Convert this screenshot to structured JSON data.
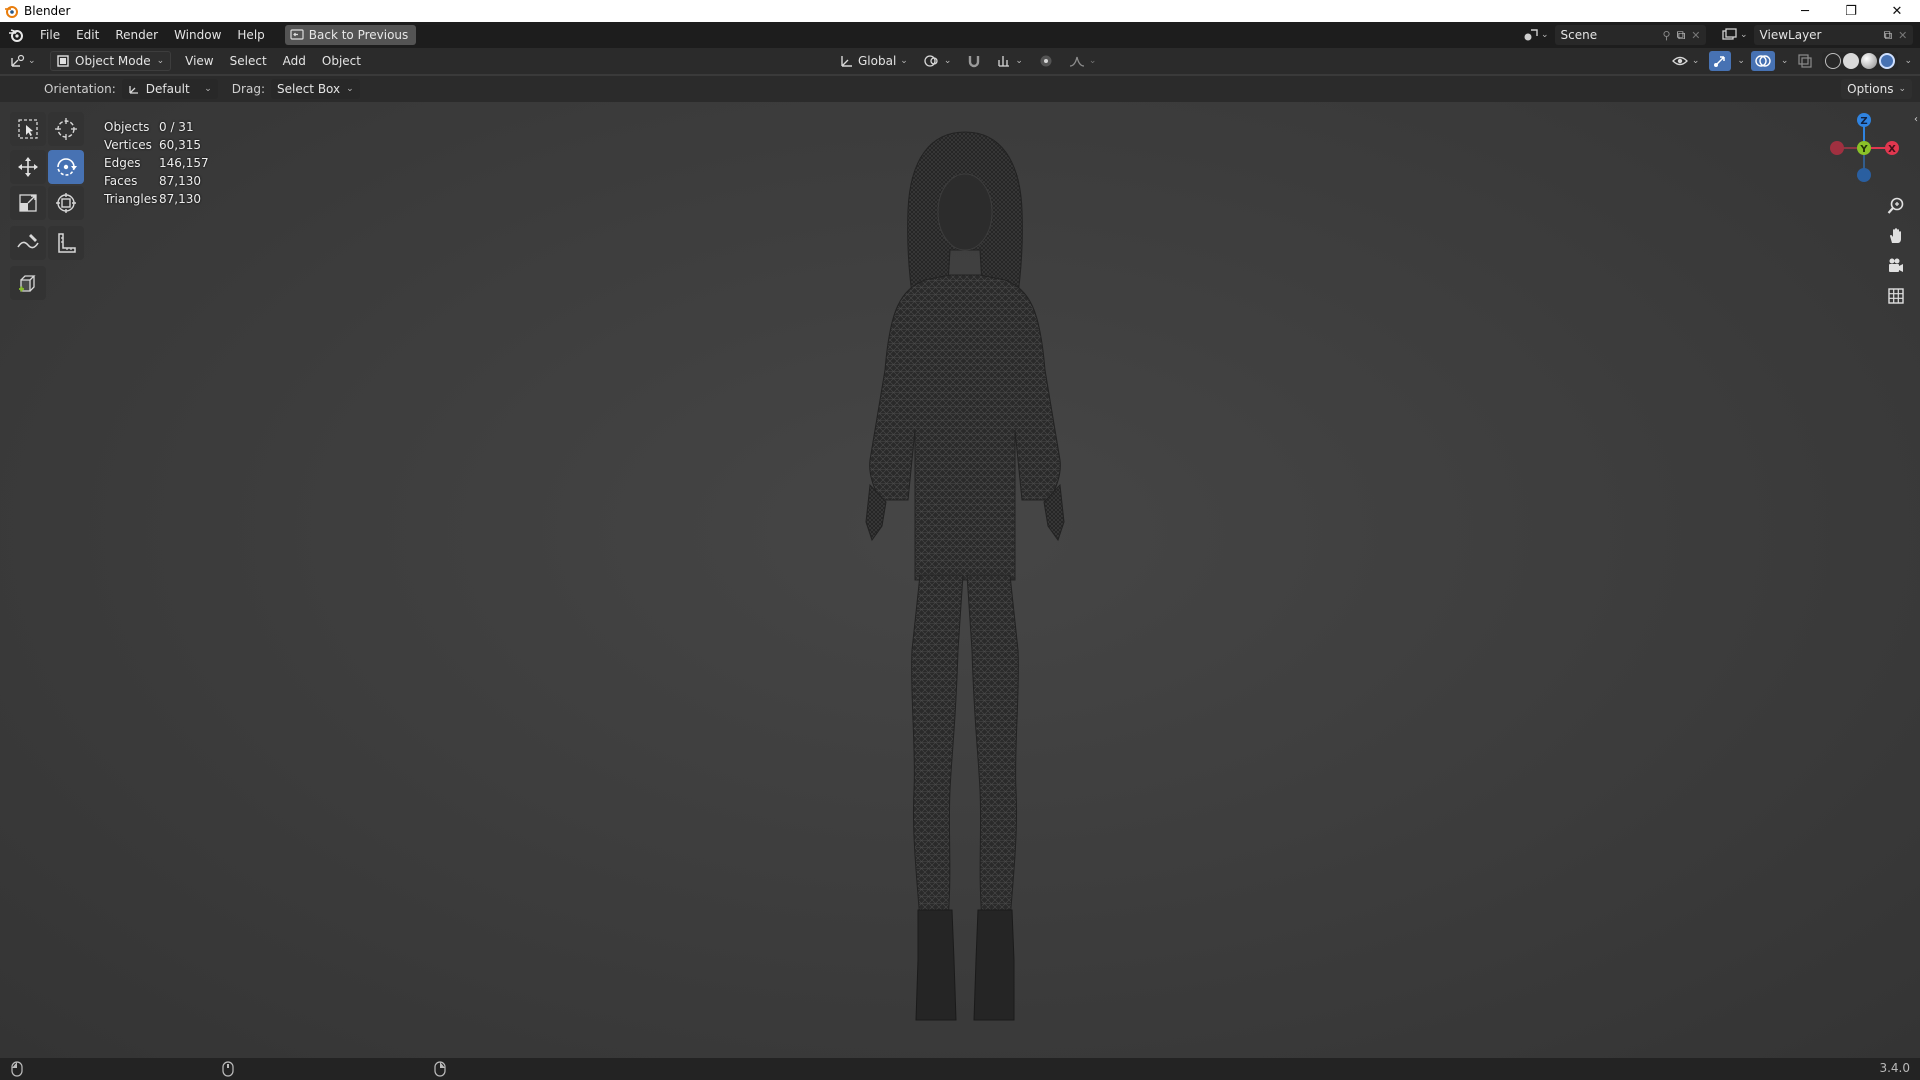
{
  "window": {
    "title": "Blender",
    "controls": {
      "minimize": "─",
      "maximize": "❐",
      "close": "✕"
    }
  },
  "menubar": {
    "items": [
      "File",
      "Edit",
      "Render",
      "Window",
      "Help"
    ],
    "back_button": "Back to Previous",
    "scene": "Scene",
    "view_layer": "ViewLayer"
  },
  "viewport_header": {
    "mode": "Object Mode",
    "menus": [
      "View",
      "Select",
      "Add",
      "Object"
    ],
    "transform_orientation": "Global",
    "orientation_label": "Orientation:",
    "orientation_value": "Default",
    "drag_label": "Drag:",
    "drag_value": "Select Box",
    "options_label": "Options"
  },
  "stats": [
    {
      "label": "Objects",
      "value": "0 / 31"
    },
    {
      "label": "Vertices",
      "value": "60,315"
    },
    {
      "label": "Edges",
      "value": "146,157"
    },
    {
      "label": "Faces",
      "value": "87,130"
    },
    {
      "label": "Triangles",
      "value": "87,130"
    }
  ],
  "gizmo": {
    "z": "Z",
    "y": "Y",
    "x": "X"
  },
  "toolbar": {
    "tools": [
      "select-box",
      "cursor",
      "move",
      "rotate",
      "scale",
      "transform",
      "annotate",
      "measure",
      "add-cube"
    ],
    "active": "rotate"
  },
  "colors": {
    "accent": "#4772b3",
    "axis_x": "#e0374f",
    "axis_y": "#8ac228",
    "axis_z": "#2f83e0"
  },
  "statusbar": {
    "version": "3.4.0"
  }
}
